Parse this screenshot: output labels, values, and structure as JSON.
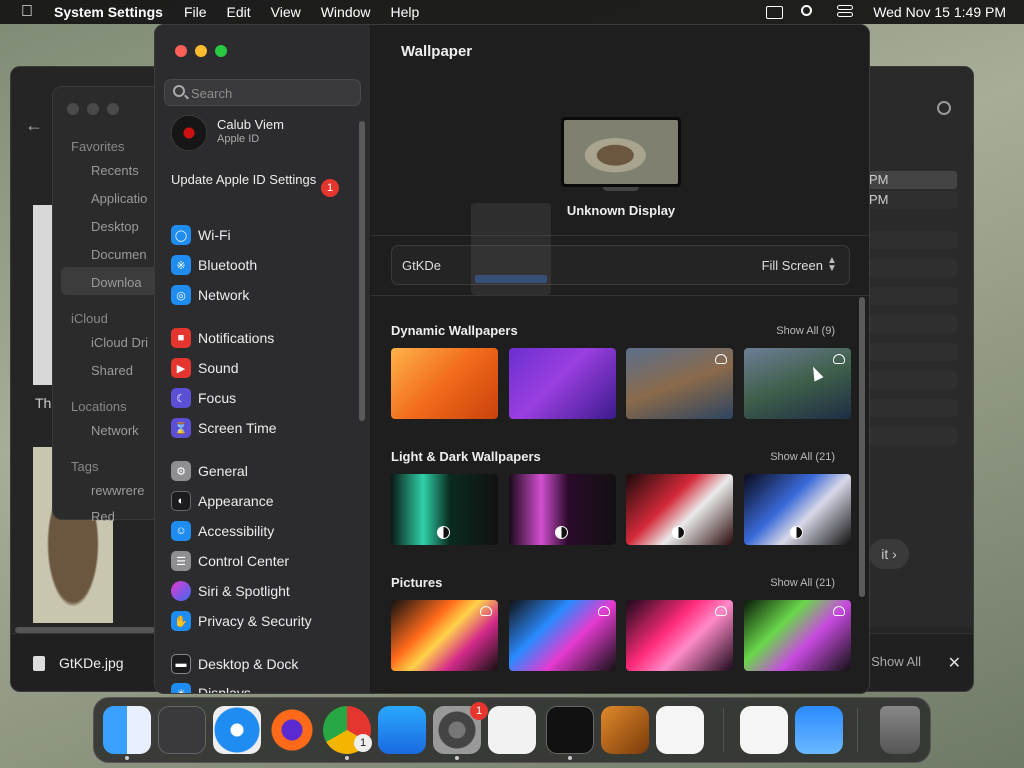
{
  "menubar": {
    "app_name": "System Settings",
    "menus": [
      "File",
      "Edit",
      "View",
      "Window",
      "Help"
    ],
    "datetime": "Wed Nov 15  1:49 PM"
  },
  "finder": {
    "favorites_label": "Favorites",
    "favorites": [
      "Recents",
      "Applicatio",
      "Desktop",
      "Documen",
      "Downloa"
    ],
    "icloud_label": "iCloud",
    "icloud": [
      "iCloud Dri",
      "Shared"
    ],
    "locations_label": "Locations",
    "locations": [
      "Network"
    ],
    "tags_label": "Tags",
    "tags": [
      "rewwrere",
      "Red"
    ],
    "file_name": "GtKDe.jpg",
    "show_all": "Show All",
    "times": [
      "PM",
      "PM"
    ],
    "side_text": "Th",
    "next_label": "it"
  },
  "sidebar": {
    "search_placeholder": "Search",
    "profile_name": "Calub Viem",
    "profile_sub": "Apple ID",
    "update_label": "Update Apple ID Settings",
    "update_badge": "1",
    "items": [
      {
        "label": "Wi-Fi",
        "icon": "wifi-icon",
        "color": "#1e8cf0"
      },
      {
        "label": "Bluetooth",
        "icon": "bluetooth-icon",
        "color": "#1e8cf0"
      },
      {
        "label": "Network",
        "icon": "globe-icon",
        "color": "#1e8cf0"
      },
      {
        "label": "Notifications",
        "icon": "bell-icon",
        "color": "#e5352f"
      },
      {
        "label": "Sound",
        "icon": "speaker-icon",
        "color": "#e5352f"
      },
      {
        "label": "Focus",
        "icon": "moon-icon",
        "color": "#5b4fd6"
      },
      {
        "label": "Screen Time",
        "icon": "hourglass-icon",
        "color": "#5b4fd6"
      },
      {
        "label": "General",
        "icon": "gear-icon",
        "color": "#8e8e93"
      },
      {
        "label": "Appearance",
        "icon": "appearance-icon",
        "color": "#1c1c1e"
      },
      {
        "label": "Accessibility",
        "icon": "accessibility-icon",
        "color": "#1e8cf0"
      },
      {
        "label": "Control Center",
        "icon": "toggles-icon",
        "color": "#8e8e93"
      },
      {
        "label": "Siri & Spotlight",
        "icon": "siri-icon",
        "color": "#b03cd6"
      },
      {
        "label": "Privacy & Security",
        "icon": "hand-icon",
        "color": "#1e8cf0"
      },
      {
        "label": "Desktop & Dock",
        "icon": "dock-icon",
        "color": "#1c1c1e"
      },
      {
        "label": "Displays",
        "icon": "display-icon",
        "color": "#1e8cf0"
      }
    ]
  },
  "content": {
    "title": "Wallpaper",
    "display_name": "Unknown Display",
    "wallpaper_name": "GtKDe",
    "fit_mode": "Fill Screen",
    "sections": [
      {
        "title": "Dynamic Wallpapers",
        "show_all": "Show All (9)"
      },
      {
        "title": "Light & Dark Wallpapers",
        "show_all": "Show All (21)"
      },
      {
        "title": "Pictures",
        "show_all": "Show All (21)"
      }
    ]
  },
  "dock": {
    "apps": [
      "Finder",
      "Launchpad",
      "Safari",
      "Firefox",
      "Chrome",
      "App Store",
      "System Settings",
      "TextEdit",
      "Terminal",
      "GarageBand",
      "VS Code",
      "Visual Studio",
      "Weather",
      "Trash"
    ],
    "chrome_badge": "1",
    "settings_badge": "1"
  }
}
